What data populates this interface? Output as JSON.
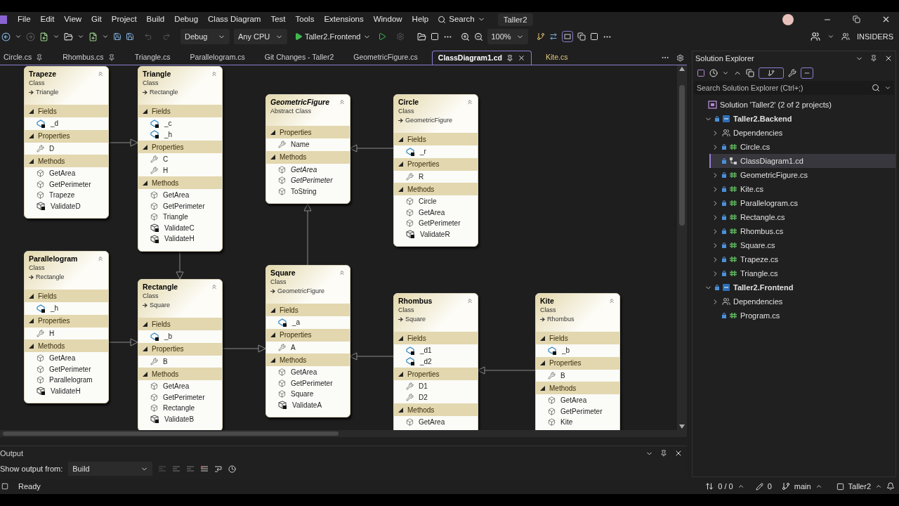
{
  "menu_bar": {
    "items": [
      "File",
      "Edit",
      "View",
      "Git",
      "Project",
      "Build",
      "Debug",
      "Class Diagram",
      "Test",
      "Tools",
      "Extensions",
      "Window",
      "Help"
    ],
    "search": "Search",
    "solution": "Taller2"
  },
  "toolbar": {
    "configuration": "Debug",
    "platform": "Any CPU",
    "startup_project": "Taller2.Frontend",
    "zoom": "100%",
    "insiders": "INSIDERS"
  },
  "tabs": [
    {
      "label": "Circle.cs",
      "pinned": true,
      "selected": false
    },
    {
      "label": "Rhombus.cs",
      "pinned": true,
      "selected": false
    },
    {
      "label": "Triangle.cs",
      "pinned": false,
      "selected": false
    },
    {
      "label": "Parallelogram.cs",
      "pinned": false,
      "selected": false
    },
    {
      "label": "Git Changes - Taller2",
      "pinned": false,
      "selected": false
    },
    {
      "label": "GeometricFigure.cs",
      "pinned": false,
      "selected": false
    },
    {
      "label": "ClassDiagram1.cd",
      "pinned": true,
      "selected": true
    },
    {
      "label": "Kite.cs",
      "pinned": false,
      "selected": false
    }
  ],
  "diagram": {
    "classes": [
      {
        "name": "Trapeze",
        "stereotype": "Class",
        "abstract": false,
        "base": "Triangle",
        "sections": [
          {
            "title": "Fields",
            "expanded": true,
            "members": [
              {
                "kind": "private_field",
                "name": "_d"
              }
            ]
          },
          {
            "title": "Properties",
            "expanded": true,
            "members": [
              {
                "kind": "property",
                "name": "D"
              }
            ]
          },
          {
            "title": "Methods",
            "expanded": true,
            "members": [
              {
                "kind": "method",
                "name": "GetArea"
              },
              {
                "kind": "method",
                "name": "GetPerimeter"
              },
              {
                "kind": "method",
                "name": "Trapeze"
              },
              {
                "kind": "private_method",
                "name": "ValidateD"
              }
            ]
          }
        ]
      },
      {
        "name": "Triangle",
        "stereotype": "Class",
        "abstract": false,
        "base": "Rectangle",
        "sections": [
          {
            "title": "Fields",
            "expanded": true,
            "members": [
              {
                "kind": "private_field",
                "name": "_c"
              },
              {
                "kind": "private_field",
                "name": "_h"
              }
            ]
          },
          {
            "title": "Properties",
            "expanded": true,
            "members": [
              {
                "kind": "property",
                "name": "C"
              },
              {
                "kind": "property",
                "name": "H"
              }
            ]
          },
          {
            "title": "Methods",
            "expanded": true,
            "members": [
              {
                "kind": "method",
                "name": "GetArea"
              },
              {
                "kind": "method",
                "name": "GetPerimeter"
              },
              {
                "kind": "method",
                "name": "Triangle"
              },
              {
                "kind": "private_method",
                "name": "ValidateC"
              },
              {
                "kind": "private_method",
                "name": "ValidateH"
              }
            ]
          }
        ]
      },
      {
        "name": "GeometricFigure",
        "stereotype": "Abstract Class",
        "abstract": true,
        "sections": [
          {
            "title": "Properties",
            "expanded": true,
            "members": [
              {
                "kind": "property",
                "name": "Name"
              }
            ]
          },
          {
            "title": "Methods",
            "expanded": true,
            "members": [
              {
                "kind": "abstract_method",
                "name": "GetArea"
              },
              {
                "kind": "abstract_method",
                "name": "GetPerimeter"
              },
              {
                "kind": "method",
                "name": "ToString"
              }
            ]
          }
        ]
      },
      {
        "name": "Circle",
        "stereotype": "Class",
        "abstract": false,
        "base": "GeometricFigure",
        "sections": [
          {
            "title": "Fields",
            "expanded": true,
            "members": [
              {
                "kind": "private_field",
                "name": "_r"
              }
            ]
          },
          {
            "title": "Properties",
            "expanded": true,
            "members": [
              {
                "kind": "property",
                "name": "R"
              }
            ]
          },
          {
            "title": "Methods",
            "expanded": true,
            "members": [
              {
                "kind": "method",
                "name": "Circle"
              },
              {
                "kind": "method",
                "name": "GetArea"
              },
              {
                "kind": "method",
                "name": "GetPerimeter"
              },
              {
                "kind": "private_method",
                "name": "ValidateR"
              }
            ]
          }
        ]
      },
      {
        "name": "Parallelogram",
        "stereotype": "Class",
        "abstract": false,
        "base": "Rectangle",
        "sections": [
          {
            "title": "Fields",
            "expanded": true,
            "members": [
              {
                "kind": "private_field",
                "name": "_h"
              }
            ]
          },
          {
            "title": "Properties",
            "expanded": true,
            "members": [
              {
                "kind": "property",
                "name": "H"
              }
            ]
          },
          {
            "title": "Methods",
            "expanded": true,
            "members": [
              {
                "kind": "method",
                "name": "GetArea"
              },
              {
                "kind": "method",
                "name": "GetPerimeter"
              },
              {
                "kind": "method",
                "name": "Parallelogram"
              },
              {
                "kind": "private_method",
                "name": "ValidateH"
              }
            ]
          }
        ]
      },
      {
        "name": "Rectangle",
        "stereotype": "Class",
        "abstract": false,
        "base": "Square",
        "sections": [
          {
            "title": "Fields",
            "expanded": true,
            "members": [
              {
                "kind": "private_field",
                "name": "_b"
              }
            ]
          },
          {
            "title": "Properties",
            "expanded": true,
            "members": [
              {
                "kind": "property",
                "name": "B"
              }
            ]
          },
          {
            "title": "Methods",
            "expanded": true,
            "members": [
              {
                "kind": "method",
                "name": "GetArea"
              },
              {
                "kind": "method",
                "name": "GetPerimeter"
              },
              {
                "kind": "method",
                "name": "Rectangle"
              },
              {
                "kind": "private_method",
                "name": "ValidateB"
              }
            ]
          }
        ]
      },
      {
        "name": "Square",
        "stereotype": "Class",
        "abstract": false,
        "base": "GeometricFigure",
        "sections": [
          {
            "title": "Fields",
            "expanded": true,
            "members": [
              {
                "kind": "private_field",
                "name": "_a"
              }
            ]
          },
          {
            "title": "Properties",
            "expanded": true,
            "members": [
              {
                "kind": "property",
                "name": "A"
              }
            ]
          },
          {
            "title": "Methods",
            "expanded": true,
            "members": [
              {
                "kind": "method",
                "name": "GetArea"
              },
              {
                "kind": "method",
                "name": "GetPerimeter"
              },
              {
                "kind": "method",
                "name": "Square"
              },
              {
                "kind": "private_method",
                "name": "ValidateA"
              }
            ]
          }
        ]
      },
      {
        "name": "Rhombus",
        "stereotype": "Class",
        "abstract": false,
        "base": "Square",
        "sections": [
          {
            "title": "Fields",
            "expanded": true,
            "members": [
              {
                "kind": "private_field",
                "name": "_d1"
              },
              {
                "kind": "private_field",
                "name": "_d2"
              }
            ]
          },
          {
            "title": "Properties",
            "expanded": true,
            "members": [
              {
                "kind": "property",
                "name": "D1"
              },
              {
                "kind": "property",
                "name": "D2"
              }
            ]
          },
          {
            "title": "Methods",
            "expanded": true,
            "members": [
              {
                "kind": "method",
                "name": "GetArea"
              }
            ]
          }
        ]
      },
      {
        "name": "Kite",
        "stereotype": "Class",
        "abstract": false,
        "base": "Rhombus",
        "sections": [
          {
            "title": "Fields",
            "expanded": true,
            "members": [
              {
                "kind": "private_field",
                "name": "_b"
              }
            ]
          },
          {
            "title": "Properties",
            "expanded": true,
            "members": [
              {
                "kind": "property",
                "name": "B"
              }
            ]
          },
          {
            "title": "Methods",
            "expanded": true,
            "members": [
              {
                "kind": "method",
                "name": "GetArea"
              },
              {
                "kind": "method",
                "name": "GetPerimeter"
              },
              {
                "kind": "method",
                "name": "Kite"
              }
            ]
          }
        ]
      }
    ]
  },
  "output": {
    "title": "Output",
    "source_label": "Show output from:",
    "source": "Build"
  },
  "solution_explorer": {
    "title": "Solution Explorer",
    "search_placeholder": "Search Solution Explorer (Ctrl+;)",
    "tree": [
      {
        "label": "Solution 'Taller2' (2 of 2 projects)",
        "kind": "solution",
        "selected": false,
        "children": [
          {
            "label": "Taller2.Backend",
            "kind": "project",
            "expandable": true,
            "expanded": true,
            "selected": false,
            "children": [
              {
                "label": "Dependencies",
                "kind": "dependencies",
                "expandable": true,
                "expanded": false,
                "selected": false
              },
              {
                "label": "Circle.cs",
                "kind": "csharp",
                "expandable": true,
                "expanded": false,
                "selected": false
              },
              {
                "label": "ClassDiagram1.cd",
                "kind": "diagram",
                "expandable": false,
                "expanded": false,
                "selected": true
              },
              {
                "label": "GeometricFigure.cs",
                "kind": "csharp",
                "expandable": true,
                "expanded": false,
                "selected": false
              },
              {
                "label": "Kite.cs",
                "kind": "csharp",
                "expandable": true,
                "expanded": false,
                "selected": false
              },
              {
                "label": "Parallelogram.cs",
                "kind": "csharp",
                "expandable": true,
                "expanded": false,
                "selected": false
              },
              {
                "label": "Rectangle.cs",
                "kind": "csharp",
                "expandable": true,
                "expanded": false,
                "selected": false
              },
              {
                "label": "Rhombus.cs",
                "kind": "csharp",
                "expandable": true,
                "expanded": false,
                "selected": false
              },
              {
                "label": "Square.cs",
                "kind": "csharp",
                "expandable": true,
                "expanded": false,
                "selected": false
              },
              {
                "label": "Trapeze.cs",
                "kind": "csharp",
                "expandable": true,
                "expanded": false,
                "selected": false
              },
              {
                "label": "Triangle.cs",
                "kind": "csharp",
                "expandable": true,
                "expanded": false,
                "selected": false
              }
            ]
          },
          {
            "label": "Taller2.Frontend",
            "kind": "project",
            "expandable": true,
            "expanded": true,
            "selected": false,
            "children": [
              {
                "label": "Dependencies",
                "kind": "dependencies",
                "expandable": true,
                "expanded": false,
                "selected": false
              },
              {
                "label": "Program.cs",
                "kind": "csharp",
                "expandable": false,
                "expanded": false,
                "selected": false
              }
            ]
          }
        ]
      }
    ]
  },
  "status_bar": {
    "state": "Ready",
    "changes": "0 / 0",
    "edits": "0",
    "branch": "main",
    "repository": "Taller2"
  }
}
